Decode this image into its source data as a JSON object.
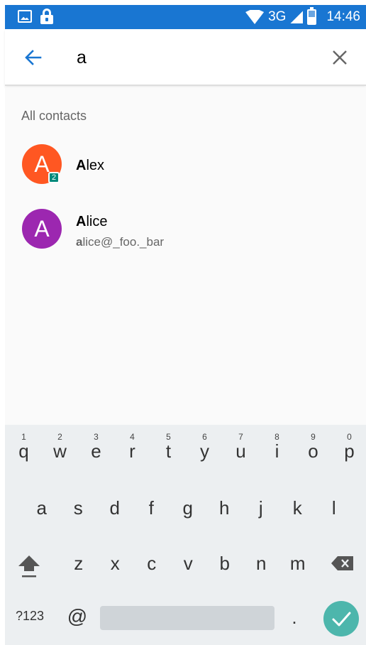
{
  "status_bar": {
    "network": "3G",
    "time": "14:46"
  },
  "search": {
    "query": "a"
  },
  "results": {
    "section_title": "All contacts",
    "contacts": [
      {
        "avatar_letter": "A",
        "avatar_color": "#ff5722",
        "name_match": "A",
        "name_rest": "lex",
        "badge": "2"
      },
      {
        "avatar_letter": "A",
        "avatar_color": "#9c27b0",
        "name_match": "A",
        "name_rest": "lice",
        "detail_match": "a",
        "detail_rest": "lice@_foo._bar"
      }
    ]
  },
  "keyboard": {
    "row1": [
      {
        "key": "q",
        "hint": "1"
      },
      {
        "key": "w",
        "hint": "2"
      },
      {
        "key": "e",
        "hint": "3"
      },
      {
        "key": "r",
        "hint": "4"
      },
      {
        "key": "t",
        "hint": "5"
      },
      {
        "key": "y",
        "hint": "6"
      },
      {
        "key": "u",
        "hint": "7"
      },
      {
        "key": "i",
        "hint": "8"
      },
      {
        "key": "o",
        "hint": "9"
      },
      {
        "key": "p",
        "hint": "0"
      }
    ],
    "row2": [
      "a",
      "s",
      "d",
      "f",
      "g",
      "h",
      "j",
      "k",
      "l"
    ],
    "row3": [
      "z",
      "x",
      "c",
      "v",
      "b",
      "n",
      "m"
    ],
    "symbols_label": "?123",
    "at_label": "@",
    "period_label": "."
  }
}
